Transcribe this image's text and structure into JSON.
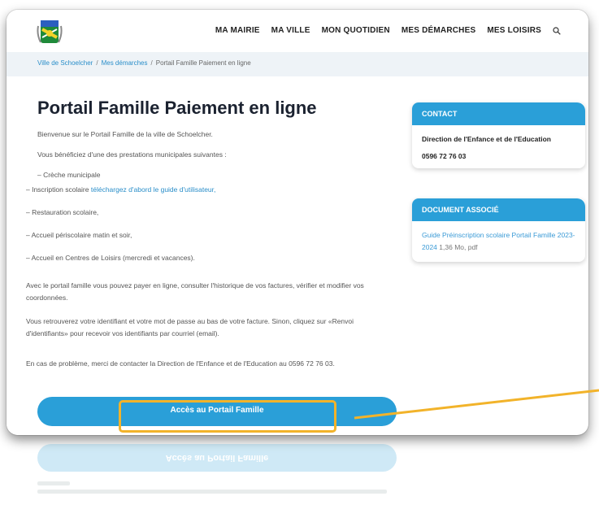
{
  "header": {
    "logo_name": "crest-logo",
    "nav": [
      "MA MAIRIE",
      "MA VILLE",
      "MON QUOTIDIEN",
      "MES DÉMARCHES",
      "MES LOISIRS"
    ],
    "search_icon": "search-icon"
  },
  "breadcrumb": {
    "home": "Ville de Schoelcher",
    "section": "Mes démarches",
    "current": "Portail Famille Paiement en ligne"
  },
  "main": {
    "title": "Portail Famille Paiement en ligne",
    "intro_1": "Bienvenue sur le Portail Famille de la ville de Schoelcher.",
    "intro_2": "Vous bénéficiez d'une des prestations municipales suivantes :",
    "list_partial": "– Crèche municipale",
    "list_item_2_prefix": "– Inscription scolaire",
    "list_item_2_link": "téléchargez d'abord le guide d'utilisateur,",
    "list_item_3": "– Restauration scolaire,",
    "list_item_4": "– Accueil périscolaire matin et soir,",
    "list_item_5": "– Accueil en Centres de Loisirs (mercredi et vacances).",
    "para_1": "Avec le portail famille vous pouvez payer en ligne, consulter l'historique de vos factures, vérifier et modifier vos coordonnées.",
    "para_2": "Vous retrouverez votre identifiant et votre mot de passe au bas de votre facture. Sinon, cliquez sur «Renvoi d'identifiants» pour recevoir vos identifiants par courriel (email).",
    "para_3": "En cas de problème, merci de contacter la Direction de l'Enfance et de l'Education au 0596 72 76 03.",
    "cta_label": "Accès au Portail Famille"
  },
  "sidebar": {
    "contact_heading": "CONTACT",
    "contact_name": "Direction de l'Enfance et de l'Education",
    "contact_phone": "0596 72 76 03",
    "doc_heading": "DOCUMENT ASSOCIÉ",
    "doc_link": "Guide Préinscription scolaire Portail Famille 2023-2024",
    "doc_meta": " 1,36 Mo, pdf"
  },
  "colors": {
    "accent": "#2a9fd8",
    "highlight": "#f2b32a",
    "link": "#2a8ec9"
  }
}
